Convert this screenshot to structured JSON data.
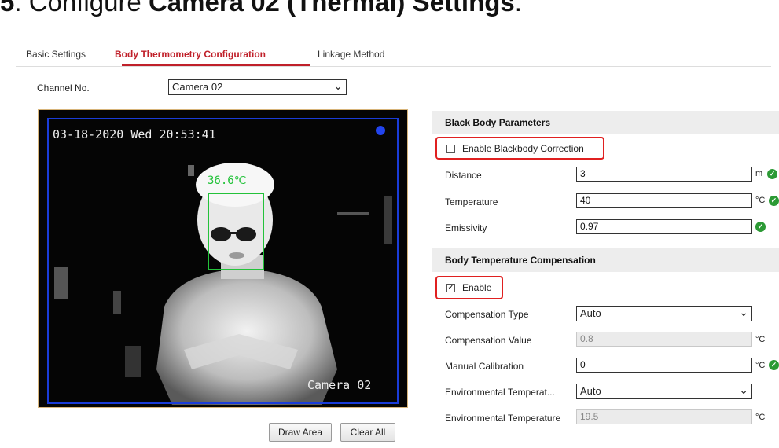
{
  "heading": {
    "step": "5",
    "text_1": ". Configure ",
    "bold": "Camera 02 (Thermal) Settings",
    "text_2": "."
  },
  "tabs": [
    {
      "label": "Basic Settings",
      "active": false
    },
    {
      "label": "Body Thermometry Configuration",
      "active": true
    },
    {
      "label": "Linkage Method",
      "active": false
    }
  ],
  "channel": {
    "label": "Channel No.",
    "value": "Camera 02"
  },
  "video": {
    "timestamp": "03-18-2020 Wed 20:53:41",
    "camera_label": "Camera 02",
    "temperature_tag": "36.6℃"
  },
  "buttons": {
    "draw_area": "Draw Area",
    "clear_all": "Clear All"
  },
  "black_body": {
    "title": "Black Body Parameters",
    "enable_label": "Enable Blackbody Correction",
    "enabled": false,
    "distance": {
      "label": "Distance",
      "value": "3",
      "unit": "m"
    },
    "temperature": {
      "label": "Temperature",
      "value": "40",
      "unit": "°C"
    },
    "emissivity": {
      "label": "Emissivity",
      "value": "0.97"
    }
  },
  "compensation": {
    "title": "Body Temperature Compensation",
    "enable_label": "Enable",
    "enabled": true,
    "type": {
      "label": "Compensation Type",
      "value": "Auto"
    },
    "value": {
      "label": "Compensation Value",
      "value": "0.8",
      "unit": "°C"
    },
    "manual_calibration": {
      "label": "Manual Calibration",
      "value": "0",
      "unit": "°C"
    },
    "env_temp_mode": {
      "label": "Environmental Temperat...",
      "value": "Auto"
    },
    "env_temp": {
      "label": "Environmental Temperature",
      "value": "19.5",
      "unit": "°C"
    }
  },
  "colors": {
    "accent": "#c0202a",
    "highlight": "#e02020",
    "valid": "#2c9a35",
    "roi": "#1a3cd8",
    "face_box": "#23c23a"
  }
}
